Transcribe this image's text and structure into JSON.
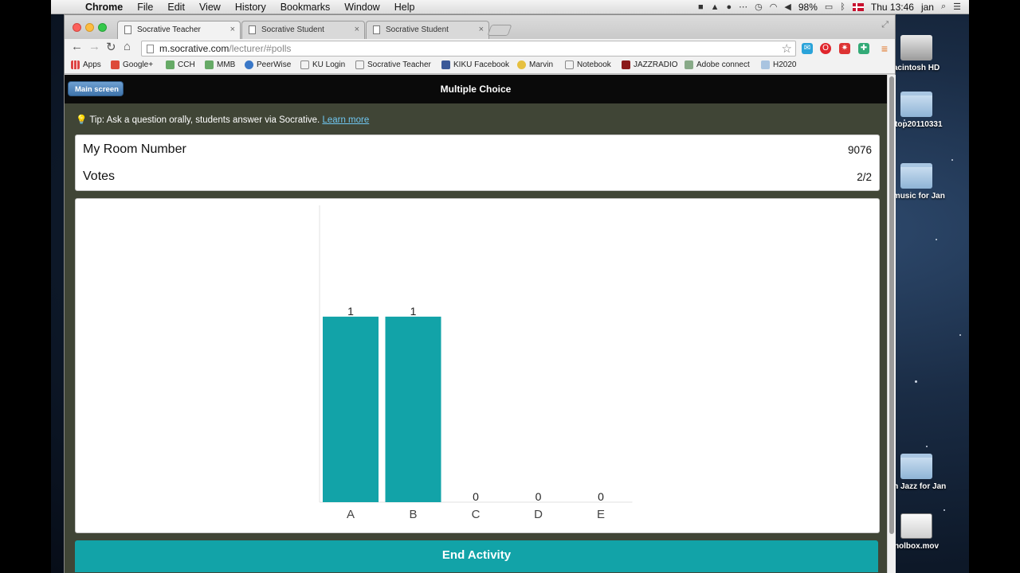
{
  "menubar": {
    "app": "Chrome",
    "items": [
      "File",
      "Edit",
      "View",
      "History",
      "Bookmarks",
      "Window",
      "Help"
    ],
    "battery": "98%",
    "clock": "Thu 13:46",
    "user": "jan"
  },
  "desktop_icons": [
    {
      "label": "acintosh HD",
      "icon": "hard-drive-icon"
    },
    {
      "label": "ktop20110331",
      "icon": "folder-icon"
    },
    {
      "label": "r music for Jan",
      "icon": "folder-icon"
    },
    {
      "label": "ish Jazz for Jan",
      "icon": "folder-icon"
    },
    {
      "label": "nolbox.mov",
      "icon": "movie-file-icon"
    }
  ],
  "browser": {
    "tabs": [
      {
        "title": "Socrative Teacher",
        "active": true
      },
      {
        "title": "Socrative Student",
        "active": false
      },
      {
        "title": "Socrative Student",
        "active": false
      }
    ],
    "url_host": "m.socrative.com",
    "url_path": "/lecturer/#polls",
    "bookmarks": [
      "Apps",
      "Google+",
      "CCH",
      "MMB",
      "PeerWise",
      "KU Login",
      "Socrative Teacher",
      "KIKU Facebook",
      "Marvin",
      "Notebook",
      "JAZZRADIO",
      "Adobe connect",
      "H2020"
    ]
  },
  "app": {
    "back_label": "Main screen",
    "title": "Multiple Choice",
    "tip_text": "Tip: Ask a question orally, students answer via Socrative.",
    "tip_link": "Learn more",
    "room_label": "My Room Number",
    "room_value": "9076",
    "votes_label": "Votes",
    "votes_value": "2/2",
    "end_button": "End Activity"
  },
  "colors": {
    "accent": "#12a3a8",
    "page_bg": "#404536",
    "header_bg": "#0a0a0a"
  },
  "chart_data": {
    "type": "bar",
    "categories": [
      "A",
      "B",
      "C",
      "D",
      "E"
    ],
    "values": [
      1,
      1,
      0,
      0,
      0
    ],
    "title": "",
    "xlabel": "",
    "ylabel": "",
    "ylim": [
      0,
      1.6
    ]
  }
}
